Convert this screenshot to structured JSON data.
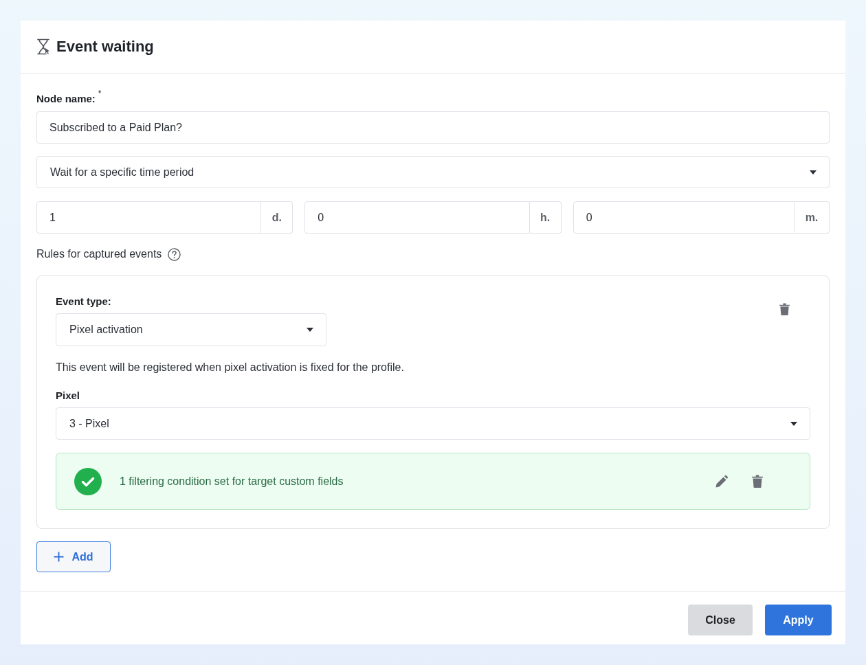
{
  "dialog": {
    "title": "Event waiting"
  },
  "node_name": {
    "label": "Node name:",
    "required_mark": "*",
    "value": "Subscribed to a Paid Plan?"
  },
  "wait_mode": {
    "value": "Wait for a specific time period"
  },
  "duration": [
    {
      "value": "1",
      "unit": "d."
    },
    {
      "value": "0",
      "unit": "h."
    },
    {
      "value": "0",
      "unit": "m."
    }
  ],
  "rules": {
    "label": "Rules for captured events",
    "items": [
      {
        "event_type_label": "Event type:",
        "event_type": "Pixel activation",
        "description": "This event will be registered when pixel activation is fixed for the profile.",
        "pixel_label": "Pixel",
        "pixel": "3 - Pixel",
        "filter": {
          "text": "1 filtering condition set for target custom fields"
        }
      }
    ]
  },
  "add_button": {
    "label": "Add"
  },
  "buttons": [
    {
      "label": "Close",
      "kind": "secondary"
    },
    {
      "label": "Apply",
      "kind": "primary"
    }
  ]
}
